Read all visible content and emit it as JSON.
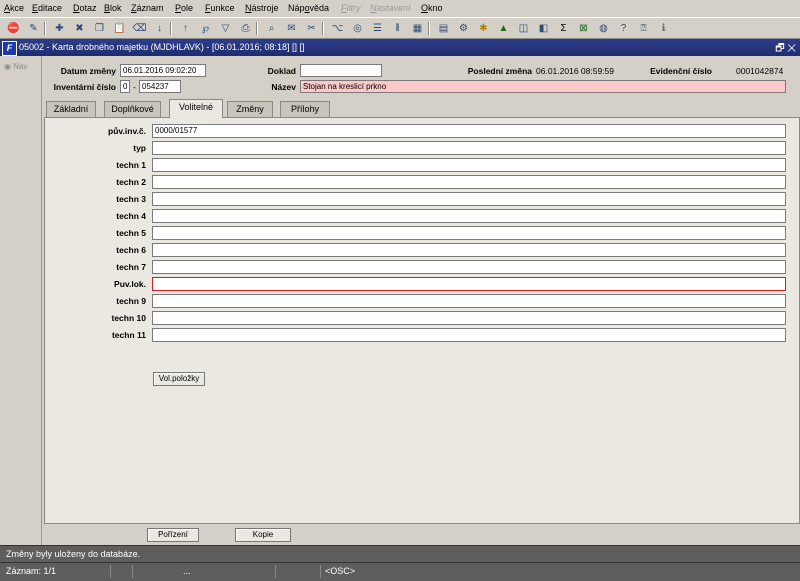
{
  "menu": [
    {
      "label": "Akce",
      "u": "A"
    },
    {
      "label": "Editace",
      "u": "E"
    },
    {
      "label": "Dotaz",
      "u": "D"
    },
    {
      "label": "Blok",
      "u": "B"
    },
    {
      "label": "Záznam",
      "u": "Z"
    },
    {
      "label": "Pole",
      "u": "P"
    },
    {
      "label": "Funkce",
      "u": "F"
    },
    {
      "label": "Nástroje",
      "u": "N"
    },
    {
      "label": "Nápověda",
      "u": "o"
    },
    {
      "label": "Filtry",
      "u": "F",
      "disabled": true
    },
    {
      "label": "Nastavení",
      "u": "N",
      "disabled": true
    },
    {
      "label": "Okno",
      "u": "O"
    }
  ],
  "toolbar_icons": [
    "exit-icon",
    "save-icon",
    "new-record-icon",
    "delete-record-icon",
    "copy-icon",
    "paste-icon",
    "clear-icon",
    "sort-asc-icon",
    "sort-desc-icon",
    "query-icon",
    "filter-icon",
    "print-icon",
    "print-preview-icon",
    "mail-icon",
    "cut-icon",
    "tree-icon",
    "binoculars-icon",
    "list-icon",
    "columns-icon",
    "calculator-icon",
    "document-icon",
    "gear-icon",
    "star-icon",
    "warning-icon",
    "chart-icon",
    "spreadsheet-icon",
    "sum-icon",
    "excel-icon",
    "globe-icon",
    "help-question-icon",
    "help-book-icon",
    "info-icon"
  ],
  "window": {
    "title": "05002 - Karta drobného majetku (MJDHLAVK) - [06.01.2016; 08:18] [] []",
    "logo": "F",
    "controls": "🗗 ✕"
  },
  "nav": {
    "label": "Nav"
  },
  "header": {
    "datum_zmeny_label": "Datum změny",
    "datum_zmeny_value": "06.01.2016 09:02:20",
    "doklad_label": "Doklad",
    "doklad_value": "",
    "posledni_zmena_label": "Poslední změna",
    "posledni_zmena_value": "06.01.2016 08:59:59",
    "evidencni_cislo_label": "Evidenční číslo",
    "evidencni_cislo_value": "0001042874",
    "inventarni_cislo_label": "Inventární číslo",
    "inventarni_prefix": "0",
    "inventarni_dash": "-",
    "inventarni_value": "054237",
    "nazev_label": "Název",
    "nazev_value": "Stojan na kreslicí prkno"
  },
  "tabs": [
    {
      "label": "Základní"
    },
    {
      "label": "Doplňkové"
    },
    {
      "label": "Volitelné",
      "active": true
    },
    {
      "label": "Změny"
    },
    {
      "label": "Přílohy"
    }
  ],
  "fields": [
    {
      "label": "pův.inv.č.",
      "value": "0000/01577"
    },
    {
      "label": "typ",
      "value": ""
    },
    {
      "label": "techn 1",
      "value": ""
    },
    {
      "label": "techn 2",
      "value": ""
    },
    {
      "label": "techn 3",
      "value": ""
    },
    {
      "label": "techn 4",
      "value": ""
    },
    {
      "label": "techn 5",
      "value": ""
    },
    {
      "label": "techn 6",
      "value": ""
    },
    {
      "label": "techn 7",
      "value": ""
    },
    {
      "label": "Puv.lok.",
      "value": "",
      "error": true
    },
    {
      "label": "techn 9",
      "value": ""
    },
    {
      "label": "techn 10",
      "value": ""
    },
    {
      "label": "techn 11",
      "value": ""
    }
  ],
  "buttons": {
    "vol_polozky": "Vol.položky",
    "porizeni": "Pořízení",
    "kopie": "Kopie"
  },
  "status": {
    "message": "Změny byly uloženy do databáze.",
    "record": "Záznam: 1/1",
    "cell3": "...",
    "mode": "<OSC>"
  }
}
